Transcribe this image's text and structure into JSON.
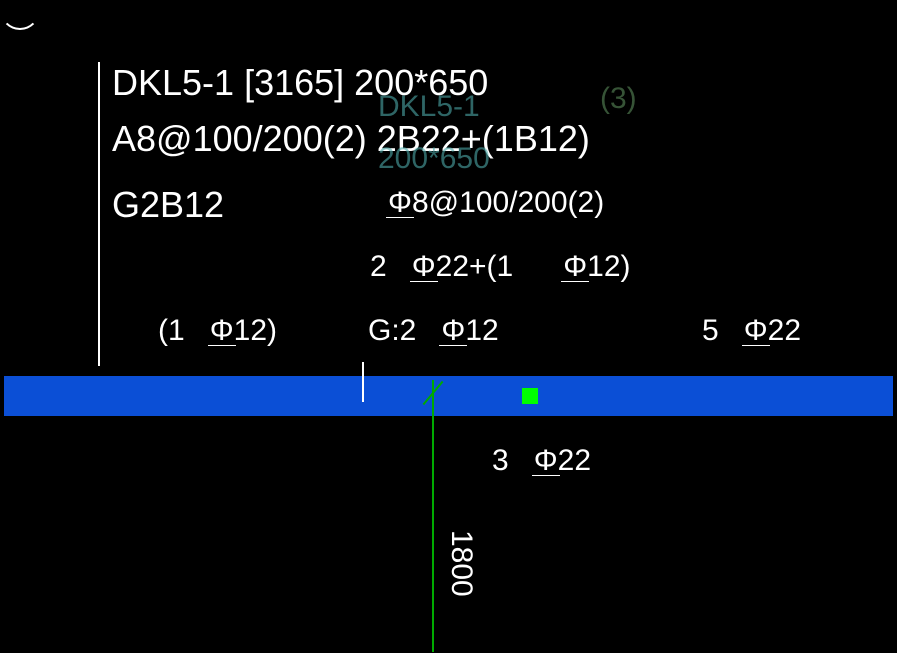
{
  "header": {
    "line1": "DKL5-1 [3165] 200*650",
    "line2": "A8@100/200(2) 2B22+(1B12)",
    "line3": "G2B12"
  },
  "faded_overlay": {
    "name": "DKL5-1",
    "count": "(3)",
    "dims": "200*650"
  },
  "annotations": {
    "stirrup": "8@100/200(2)",
    "top_bar_1": "2",
    "top_bar_2": "22+(1",
    "top_bar_3": "12)",
    "left_extra": "(1",
    "left_extra_size": "12)",
    "g_label": "G:2",
    "g_size": "12",
    "right_count": "5",
    "right_size": "22",
    "bottom_count": "3",
    "bottom_size": "22",
    "dimension": "1800"
  }
}
